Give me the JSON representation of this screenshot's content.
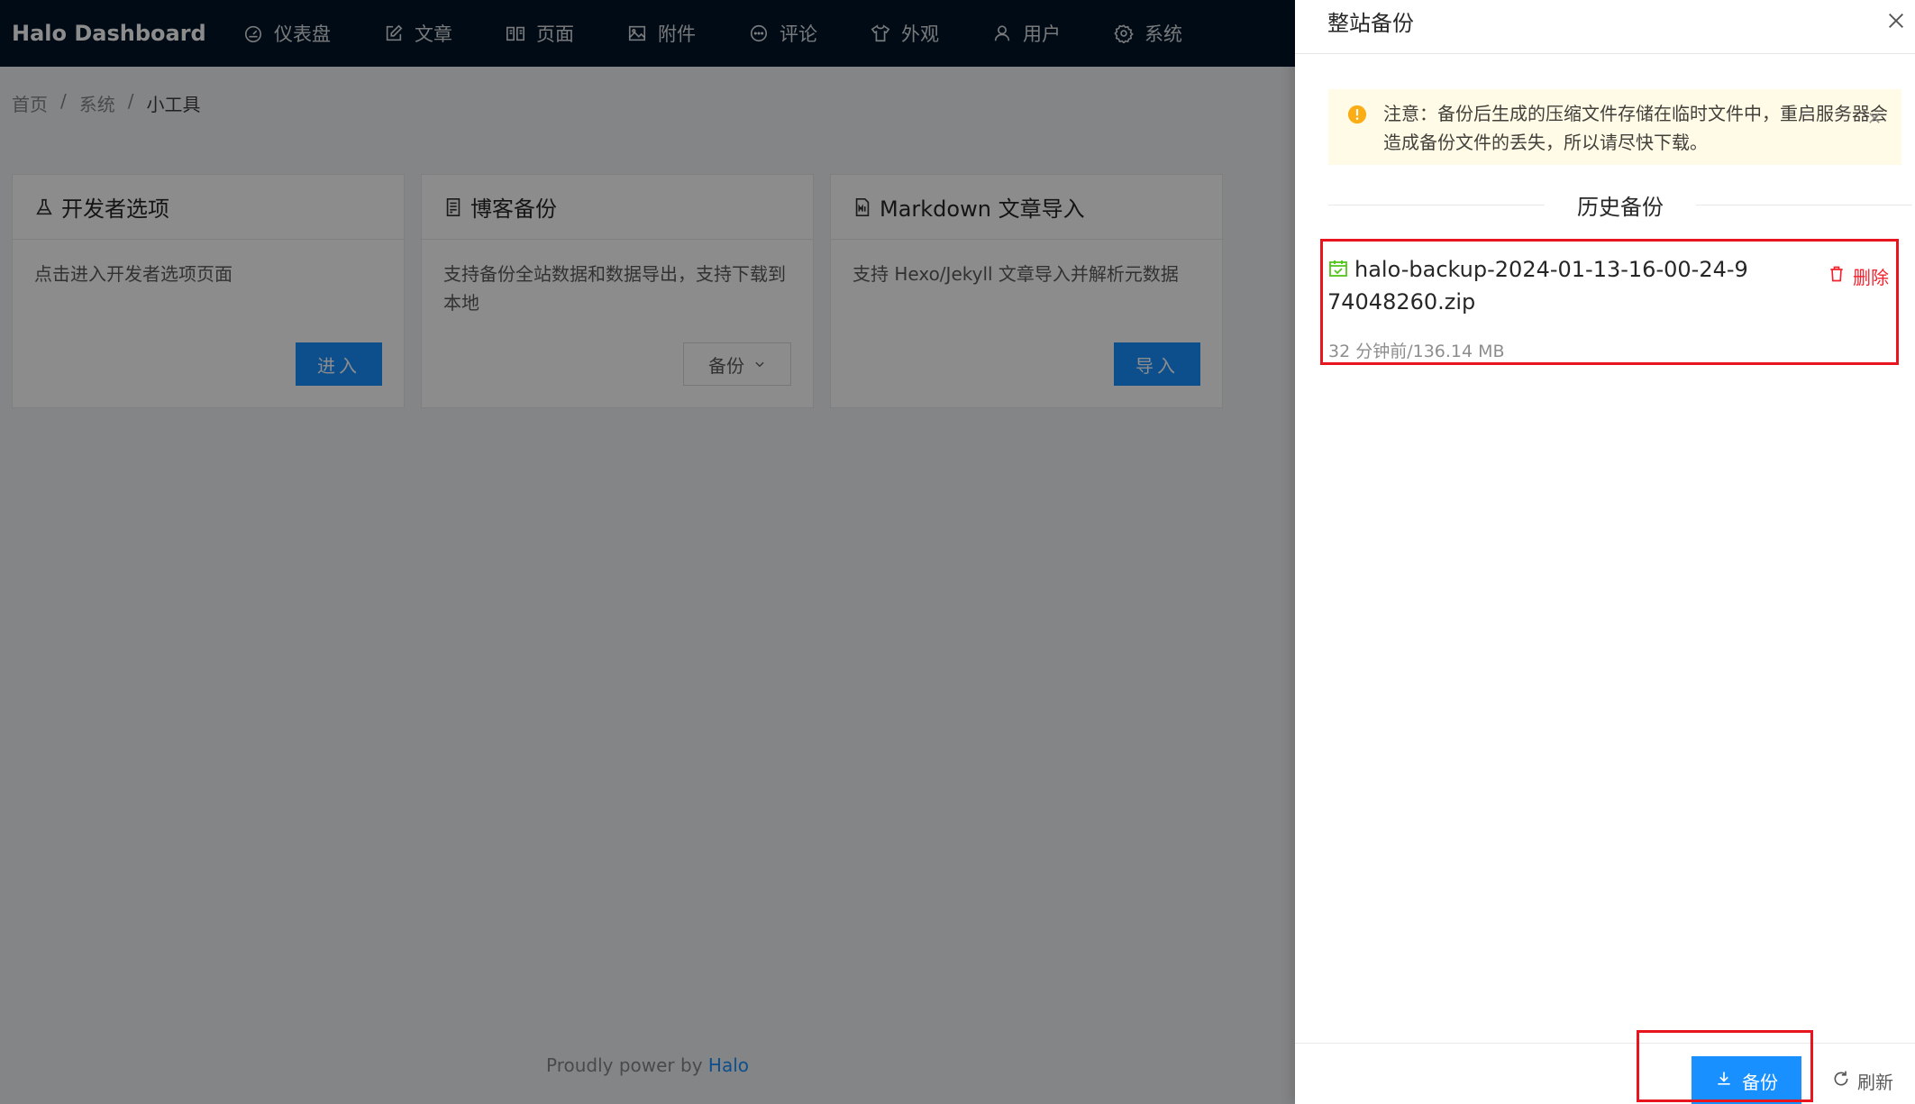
{
  "header": {
    "brand": "Halo  Dashboard",
    "nav": [
      {
        "label": "仪表盘",
        "icon": "dashboard-icon"
      },
      {
        "label": "文章",
        "icon": "edit-icon"
      },
      {
        "label": "页面",
        "icon": "book-icon"
      },
      {
        "label": "附件",
        "icon": "picture-icon"
      },
      {
        "label": "评论",
        "icon": "comment-icon"
      },
      {
        "label": "外观",
        "icon": "skin-icon"
      },
      {
        "label": "用户",
        "icon": "user-icon"
      },
      {
        "label": "系统",
        "icon": "setting-icon"
      }
    ]
  },
  "breadcrumb": {
    "items": [
      "首页",
      "系统",
      "小工具"
    ],
    "separator": "/"
  },
  "cards": [
    {
      "title": "开发者选项",
      "icon": "experiment-icon",
      "desc": "点击进入开发者选项页面",
      "button": "进入"
    },
    {
      "title": "博客备份",
      "icon": "hdd-icon",
      "desc": "支持备份全站数据和数据导出，支持下载到本地",
      "button": "备份"
    },
    {
      "title": "Markdown 文章导入",
      "icon": "file-markdown-icon",
      "desc": "支持 Hexo/Jekyll 文章导入并解析元数据",
      "button": "导入"
    }
  ],
  "footer": {
    "text": "Proudly power by ",
    "link": "Halo"
  },
  "drawer": {
    "title": "整站备份",
    "alert": "注意：备份后生成的压缩文件存储在临时文件中，重启服务器会造成备份文件的丢失，所以请尽快下载。",
    "history_title": "历史备份",
    "backups": [
      {
        "filename": "halo-backup-2024-01-13-16-00-24-974048260.zip",
        "meta": "32 分钟前/136.14 MB",
        "delete": "删除"
      }
    ],
    "backup_button": "备份",
    "refresh_button": "刷新"
  },
  "colors": {
    "nav_bg": "#001529",
    "primary": "#1890ff",
    "danger": "#f5222d",
    "alert_bg": "#fffbe6",
    "highlight": "#e8141e"
  }
}
